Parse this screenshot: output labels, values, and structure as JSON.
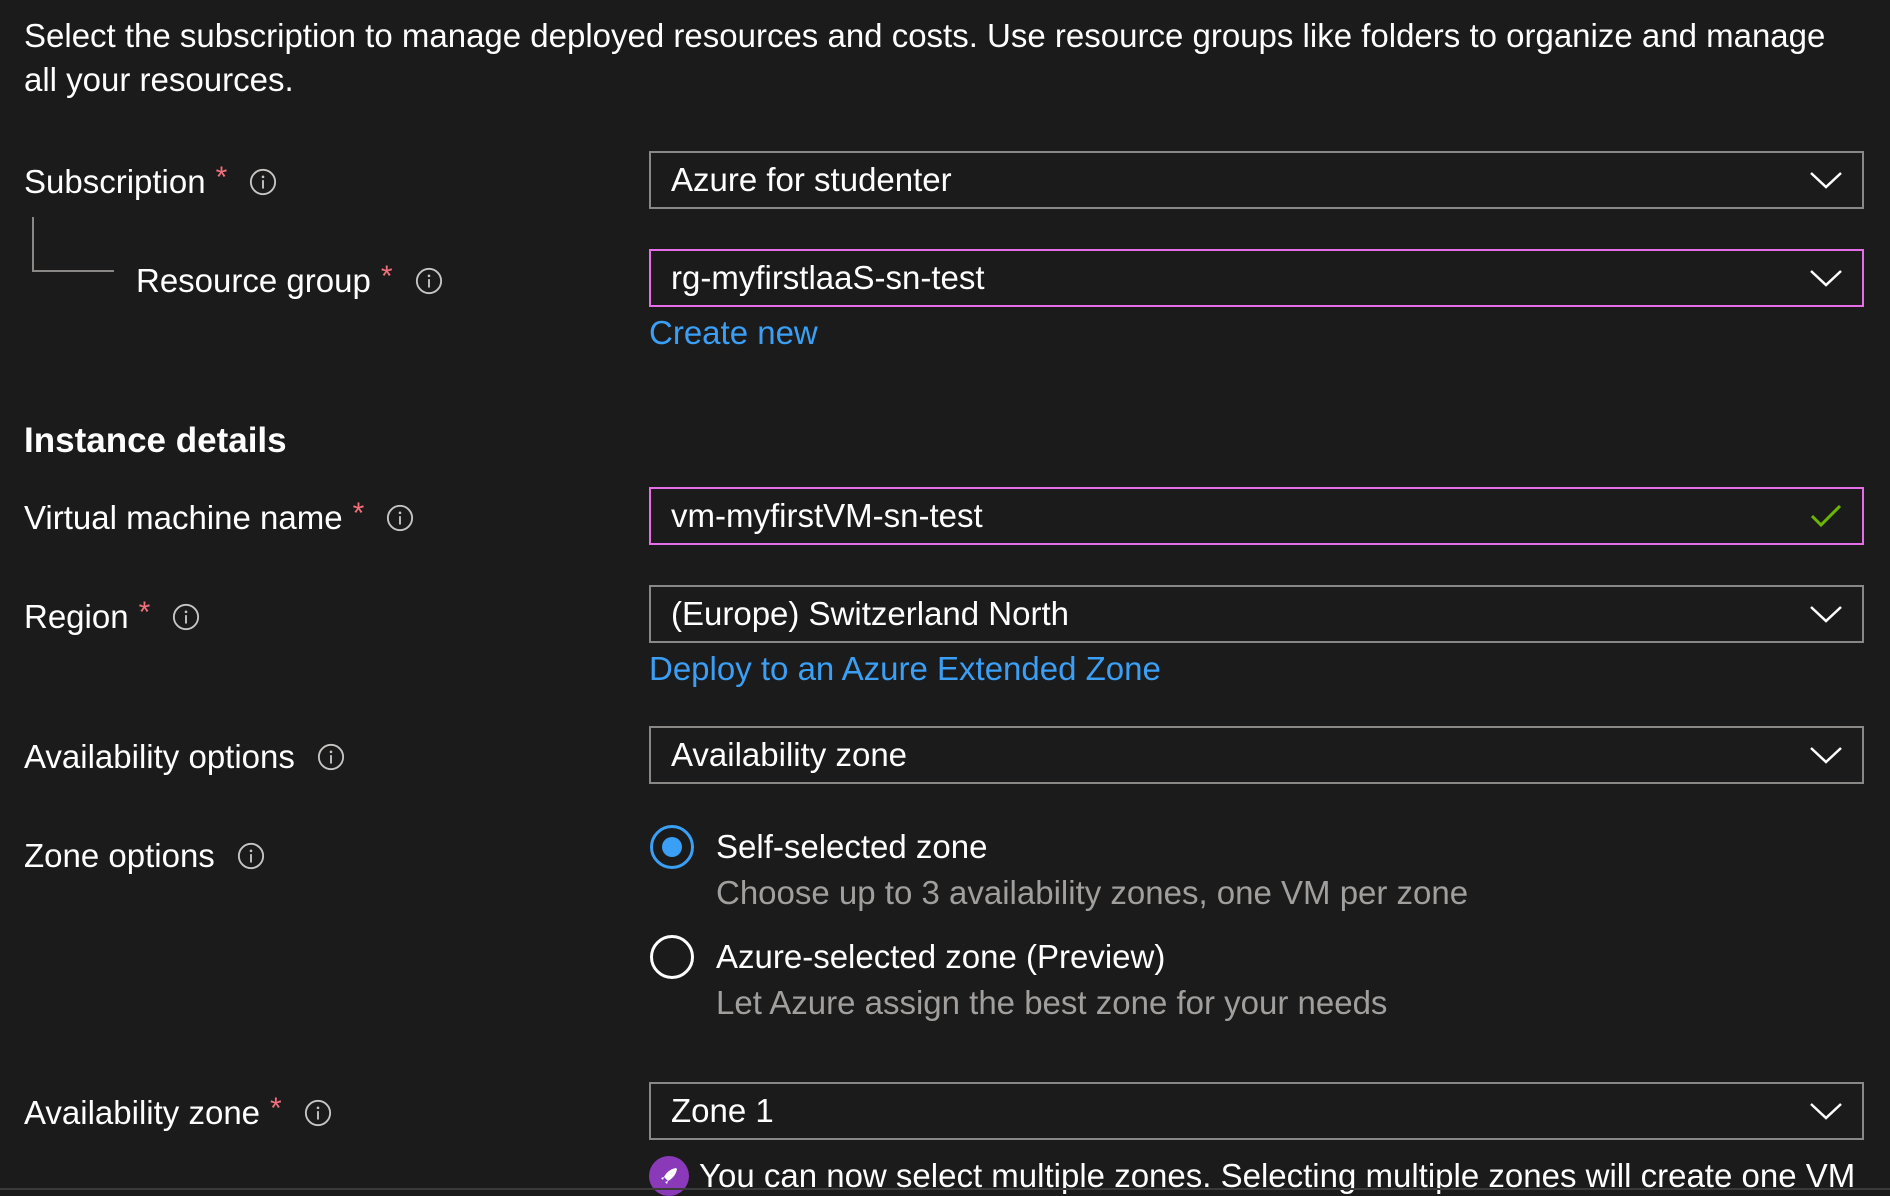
{
  "intro": "Select the subscription to manage deployed resources and costs. Use resource groups like folders to organize and manage all your resources.",
  "required_marker": "*",
  "subscription": {
    "label": "Subscription",
    "value": "Azure for studenter"
  },
  "resource_group": {
    "label": "Resource group",
    "value": "rg-myfirstlaaS-sn-test",
    "create_new": "Create new"
  },
  "instance_details": {
    "title": "Instance details"
  },
  "vm_name": {
    "label": "Virtual machine name",
    "value": "vm-myfirstVM-sn-test",
    "valid": true
  },
  "region": {
    "label": "Region",
    "value": "(Europe) Switzerland North",
    "extended_zone_link": "Deploy to an Azure Extended Zone"
  },
  "availability_options": {
    "label": "Availability options",
    "value": "Availability zone"
  },
  "zone_options": {
    "label": "Zone options",
    "options": [
      {
        "title": "Self-selected zone",
        "description": "Choose up to 3 availability zones, one VM per zone",
        "selected": true
      },
      {
        "title": "Azure-selected zone (Preview)",
        "description": "Let Azure assign the best zone for your needs",
        "selected": false
      }
    ]
  },
  "availability_zone": {
    "label": "Availability zone",
    "value": "Zone 1",
    "notice": "You can now select multiple zones. Selecting multiple zones will create one VM"
  },
  "colors": {
    "background": "#1b1b1b",
    "text": "#ffffff",
    "field_border": "#8a8886",
    "focus_border": "#e56de8",
    "link": "#3a9ff5",
    "required": "#f1707b",
    "valid_check": "#6bb700",
    "notice_icon": "#8a3ab9"
  },
  "icons": {
    "info": "info-circle-icon",
    "dropdown": "chevron-down-icon",
    "valid": "checkmark-icon",
    "notice": "rocket-icon"
  }
}
